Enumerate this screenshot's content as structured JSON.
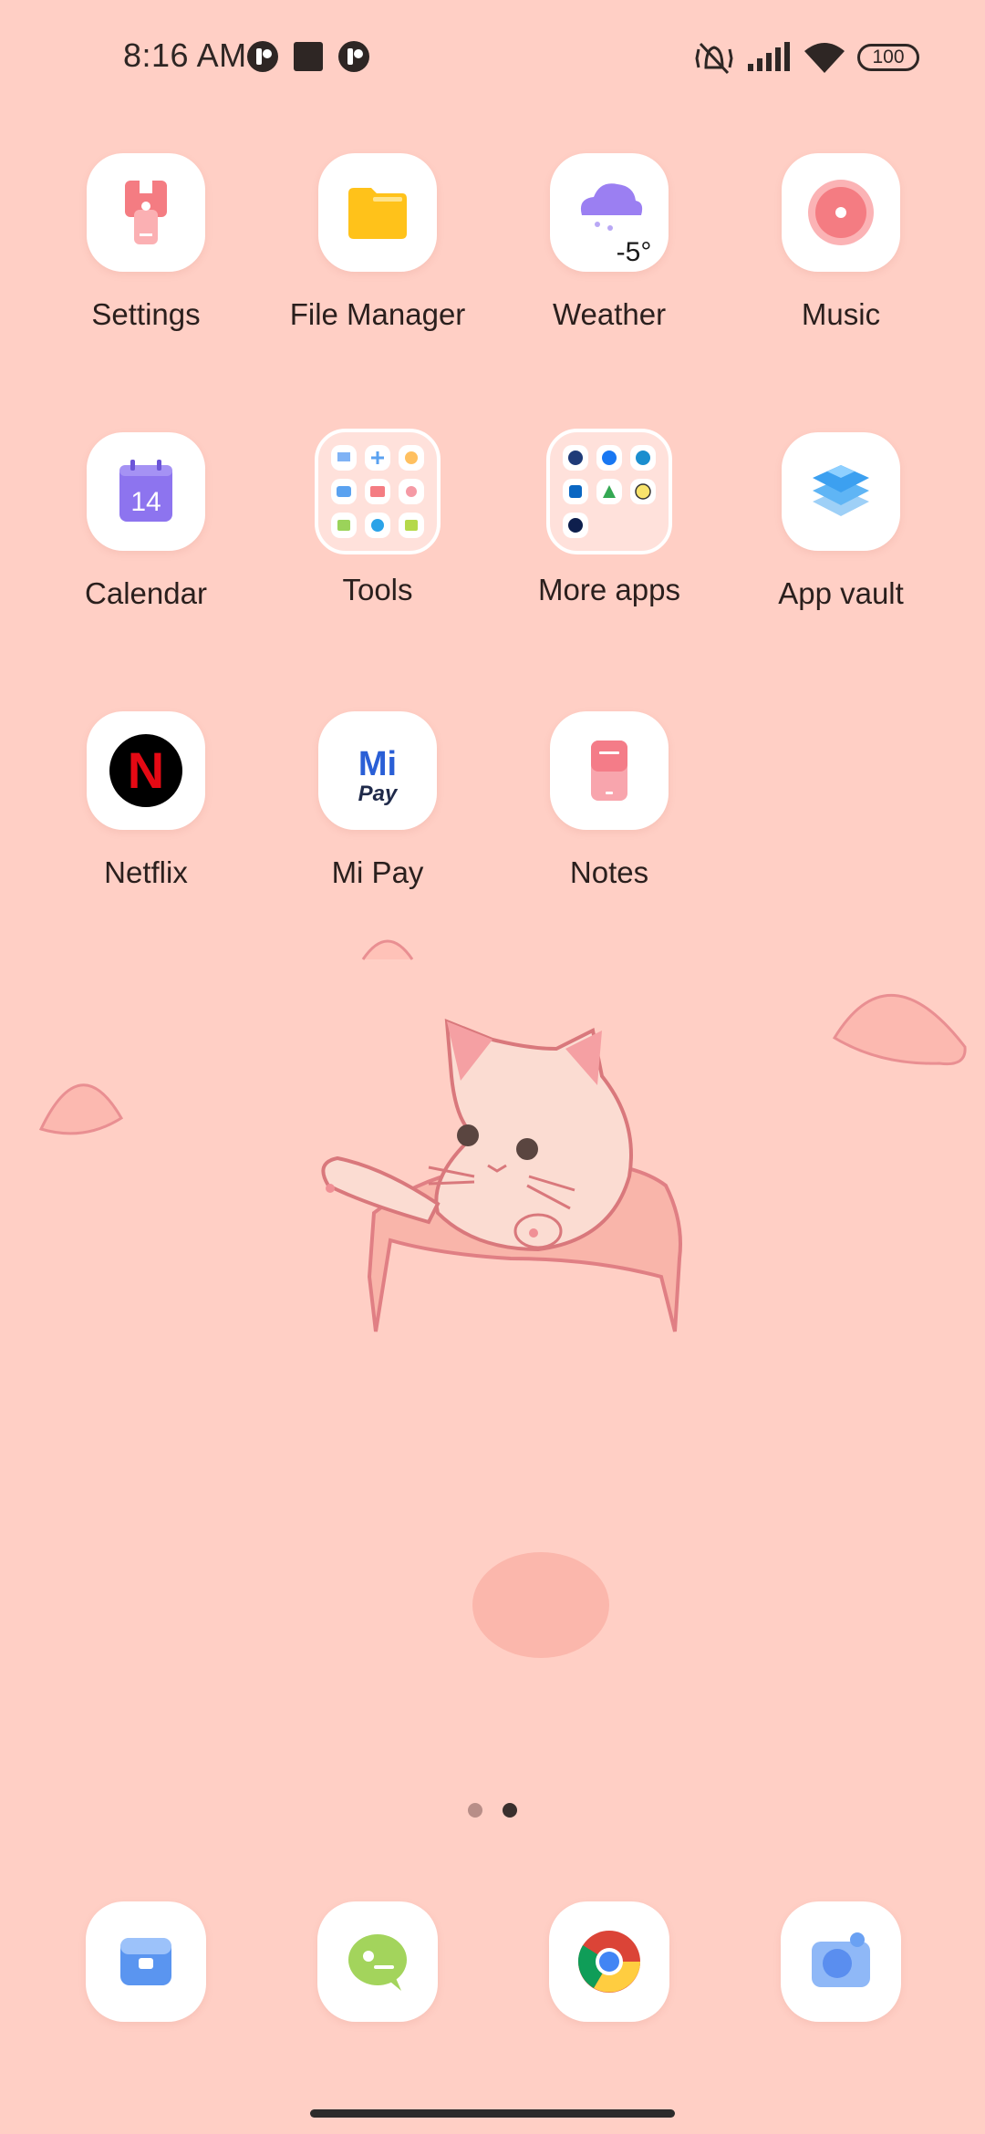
{
  "status_bar": {
    "time": "8:16 AM",
    "battery": "100",
    "left_icons": [
      "notification-app-icon",
      "stop-square-icon",
      "notification-app-icon"
    ],
    "right_icons": [
      "vibrate-off-icon",
      "signal-bars-icon",
      "wifi-icon",
      "battery-icon"
    ]
  },
  "apps": [
    {
      "label": "Settings",
      "icon": "settings-icon"
    },
    {
      "label": "File Manager",
      "icon": "folder-icon"
    },
    {
      "label": "Weather",
      "icon": "weather-cloud-icon",
      "temp": "-5°"
    },
    {
      "label": "Music",
      "icon": "music-disc-icon"
    },
    {
      "label": "Calendar",
      "icon": "calendar-icon",
      "day": "14"
    },
    {
      "label": "Tools",
      "icon": "folder-group-icon"
    },
    {
      "label": "More apps",
      "icon": "folder-group-icon"
    },
    {
      "label": "App vault",
      "icon": "app-vault-icon"
    },
    {
      "label": "Netflix",
      "icon": "netflix-icon",
      "glyph": "N"
    },
    {
      "label": "Mi Pay",
      "icon": "mi-pay-icon",
      "logo_top": "Mi",
      "logo_bottom": "Pay"
    },
    {
      "label": "Notes",
      "icon": "notes-icon"
    }
  ],
  "page_indicator": {
    "total": 2,
    "current": 2
  },
  "dock": [
    {
      "name": "phone",
      "icon": "phone-icon"
    },
    {
      "name": "messaging",
      "icon": "messaging-icon"
    },
    {
      "name": "chrome",
      "icon": "chrome-icon"
    },
    {
      "name": "camera",
      "icon": "camera-icon"
    }
  ],
  "colors": {
    "wallpaper": "#ffcfc5",
    "text": "#2a1f1d",
    "accent_pink": "#f47c82",
    "folder_yellow": "#ffc21a",
    "weather_purple": "#9b7ff2",
    "calendar_purple": "#8d74ef",
    "netflix_red": "#e50914",
    "mipay_blue": "#2a5fd6"
  }
}
